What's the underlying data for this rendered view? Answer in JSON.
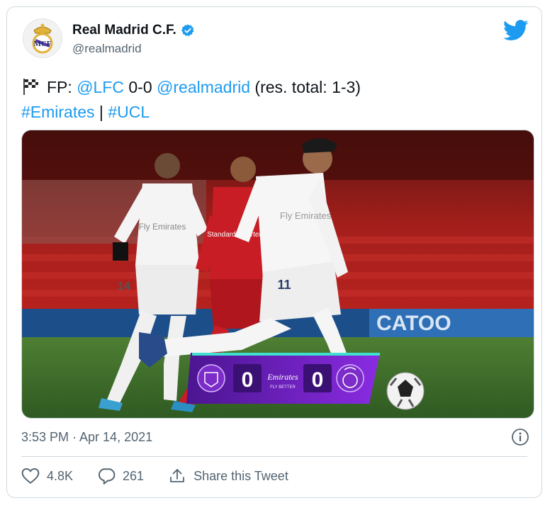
{
  "account": {
    "display_name": "Real Madrid C.F.",
    "handle": "@realmadrid",
    "verified": true,
    "avatar_icon": "real-madrid-crest-icon"
  },
  "platform_icon": "twitter-bird-icon",
  "tweet": {
    "flag_icon": "chequered-flag-icon",
    "line1_prefix": "FP: ",
    "mention1": "@LFC",
    "score_text": " 0-0 ",
    "mention2": "@realmadrid",
    "line1_suffix": " (res. total: 1-3)",
    "hashtag1": "#Emirates",
    "separator": " | ",
    "hashtag2": "#UCL"
  },
  "media": {
    "scoreboard": {
      "home_score": "0",
      "away_score": "0",
      "sponsor": "Emirates",
      "sponsor_sub": "FLY BETTER"
    },
    "stadium_board_text": "CATOO",
    "player_numbers": [
      "14",
      "11"
    ],
    "shirt_sponsor": "Fly Emirates",
    "opponent_sponsor": "Standard Chartered"
  },
  "meta": {
    "timestamp": "3:53 PM · Apr 14, 2021"
  },
  "actions": {
    "likes": "4.8K",
    "replies": "261",
    "share_label": "Share this Tweet"
  },
  "colors": {
    "link": "#1d9bf0",
    "secondary_text": "#536471",
    "border": "#cfd9de",
    "scoreboard_purple": "#6a1ec9"
  }
}
